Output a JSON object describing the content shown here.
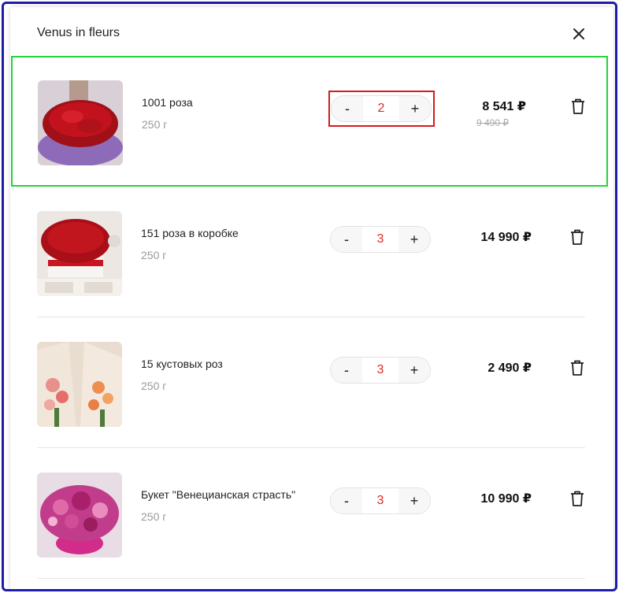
{
  "header": {
    "store_name": "Venus in fleurs"
  },
  "icons": {
    "close": "close-icon",
    "delete": "trash-icon"
  },
  "colors": {
    "quantity": "#e02a2a",
    "highlight_row": "#22d33a",
    "highlight_stepper": "#d21c1c",
    "frame": "#1c1ca8"
  },
  "items": [
    {
      "name": "1001 роза",
      "weight": "250 г",
      "minus": "-",
      "quantity": "2",
      "plus": "+",
      "price": "8 541 ₽",
      "old_price": "9 490 ₽"
    },
    {
      "name": "151 роза в коробке",
      "weight": "250 г",
      "minus": "-",
      "quantity": "3",
      "plus": "+",
      "price": "14 990 ₽",
      "old_price": ""
    },
    {
      "name": "15 кустовых роз",
      "weight": "250 г",
      "minus": "-",
      "quantity": "3",
      "plus": "+",
      "price": "2 490 ₽",
      "old_price": ""
    },
    {
      "name": "Букет \"Венецианская страсть\"",
      "weight": "250 г",
      "minus": "-",
      "quantity": "3",
      "plus": "+",
      "price": "10 990 ₽",
      "old_price": ""
    }
  ]
}
